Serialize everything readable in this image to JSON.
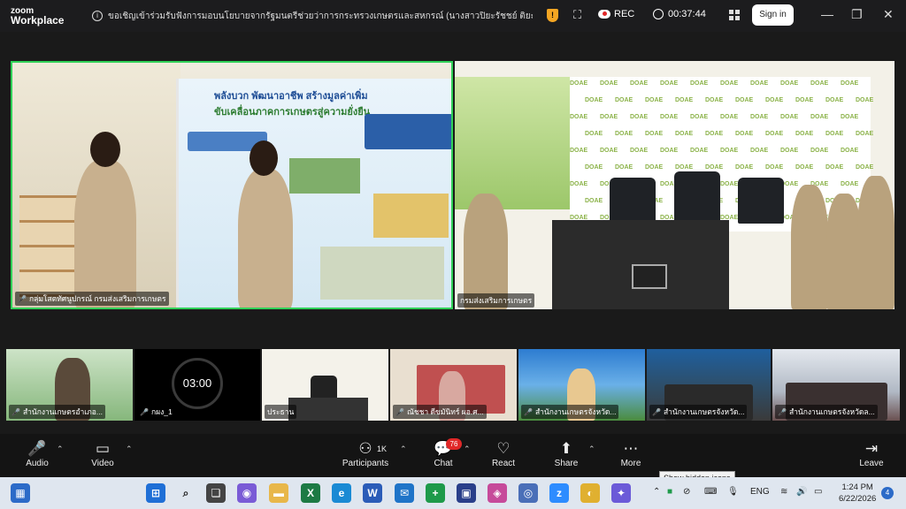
{
  "titlebar": {
    "logo_line1": "zoom",
    "logo_line2": "Workplace",
    "marquee": "ขอเชิญเข้าร่วมรับฟังการมอบนโยบายจากรัฐมนตรีช่วยว่าการกระทรวงเกษตรและสหกรณ์ (นางสาวปิยะรัชชย์ ติยะไพรัช) ภายใต้โครงการ",
    "rec_label": "REC",
    "timer": "00:37:44",
    "signin_label": "Sign in"
  },
  "main_tiles": [
    {
      "name": "กลุ่มโสตทัศนูปกรณ์ กรมส่งเสริมการเกษตร",
      "muted": true,
      "active_speaker": true
    },
    {
      "name": "กรมส่งเสริมการเกษตร",
      "muted": false,
      "active_speaker": false
    }
  ],
  "banner": {
    "line1": "พลังบวก พัฒนาอาชีพ สร้างมูลค่าเพิ่ม",
    "line2": "ขับเคลื่อนภาคการเกษตรสู่ความยั่งยืน"
  },
  "thumbnails": [
    {
      "name": "สำนักงานเกษตรอำเภอ...",
      "muted": true
    },
    {
      "name": "กผง_1",
      "muted": true,
      "countdown": "03:00"
    },
    {
      "name": "ประธาน",
      "muted": false
    },
    {
      "name": "ณัชชา ดีขมันิทร์ ผอ.ศ...",
      "muted": true
    },
    {
      "name": "สำนักงานเกษตรจังหวัด...",
      "muted": true
    },
    {
      "name": "สำนักงานเกษตรจังหวัด...",
      "muted": true
    },
    {
      "name": "สำนักงานเกษตรจังหวัดล...",
      "muted": true
    }
  ],
  "toolbar": {
    "audio": "Audio",
    "video": "Video",
    "participants": "Participants",
    "participants_count": "1K",
    "chat": "Chat",
    "chat_badge": "76",
    "react": "React",
    "share": "Share",
    "more": "More",
    "leave": "Leave"
  },
  "tooltip": "Show hidden icons",
  "taskbar": {
    "language": "ENG",
    "time": "1:24 PM",
    "date": "6/22/2026",
    "notifications": "4"
  },
  "colors": {
    "active_speaker_border": "#30d158",
    "mic_muted": "#ff4d4d",
    "chat_badge": "#e02828",
    "toolbar_bg": "#141414"
  }
}
